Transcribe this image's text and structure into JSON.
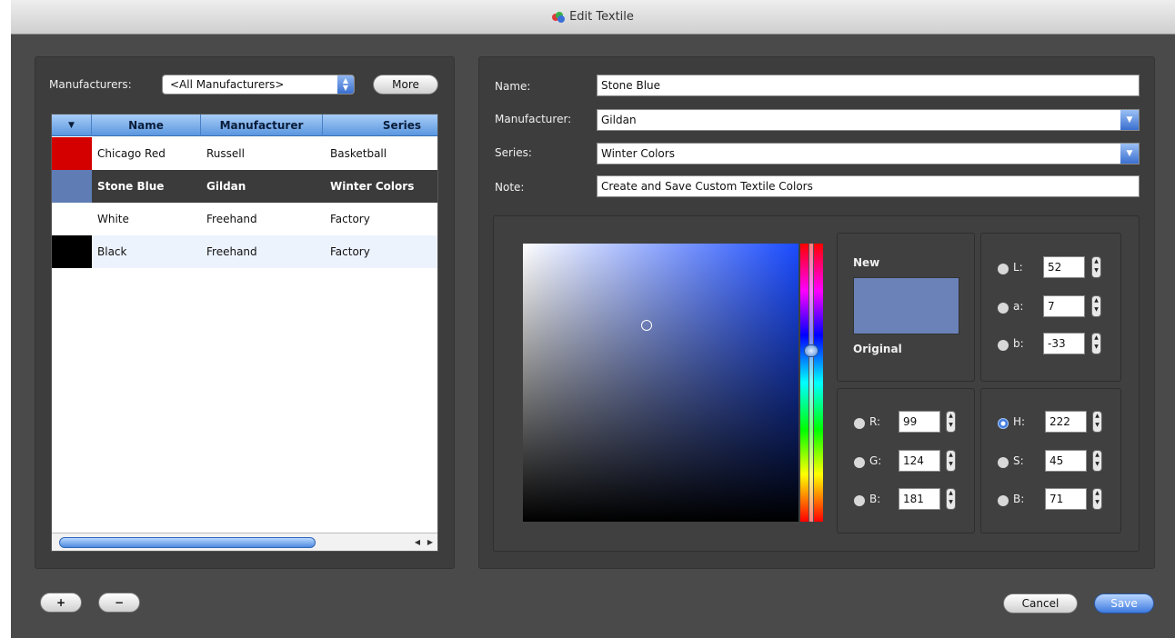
{
  "window": {
    "title": "Edit Textile"
  },
  "left": {
    "manufacturers_label": "Manufacturers:",
    "manufacturers_value": "<All Manufacturers>",
    "more_label": "More",
    "columns": [
      "Name",
      "Manufacturer",
      "Series"
    ],
    "rows": [
      {
        "swatch": "#d40000",
        "name": "Chicago Red",
        "manufacturer": "Russell",
        "series": "Basketball"
      },
      {
        "swatch": "#5f7cb5",
        "name": "Stone Blue",
        "manufacturer": "Gildan",
        "series": "Winter Colors"
      },
      {
        "swatch": "#ffffff",
        "name": "White",
        "manufacturer": "Freehand",
        "series": "Factory"
      },
      {
        "swatch": "#000000",
        "name": "Black",
        "manufacturer": "Freehand",
        "series": "Factory"
      }
    ],
    "add_label": "+",
    "remove_label": "−"
  },
  "form": {
    "name_label": "Name:",
    "name_value": "Stone Blue",
    "manufacturer_label": "Manufacturer:",
    "manufacturer_value": "Gildan",
    "series_label": "Series:",
    "series_value": "Winter Colors",
    "note_label": "Note:",
    "note_value": "Create and Save Custom Textile Colors"
  },
  "color": {
    "new_label": "New",
    "original_label": "Original",
    "swatch": "#6a82b8",
    "lab": [
      {
        "label": "L:",
        "value": "52"
      },
      {
        "label": "a:",
        "value": "7"
      },
      {
        "label": "b:",
        "value": "-33"
      }
    ],
    "rgb": [
      {
        "label": "R:",
        "value": "99"
      },
      {
        "label": "G:",
        "value": "124"
      },
      {
        "label": "B:",
        "value": "181"
      }
    ],
    "hsb": [
      {
        "label": "H:",
        "value": "222"
      },
      {
        "label": "S:",
        "value": "45"
      },
      {
        "label": "B:",
        "value": "71"
      }
    ],
    "selected_mode": "H"
  },
  "footer": {
    "cancel_label": "Cancel",
    "save_label": "Save"
  }
}
